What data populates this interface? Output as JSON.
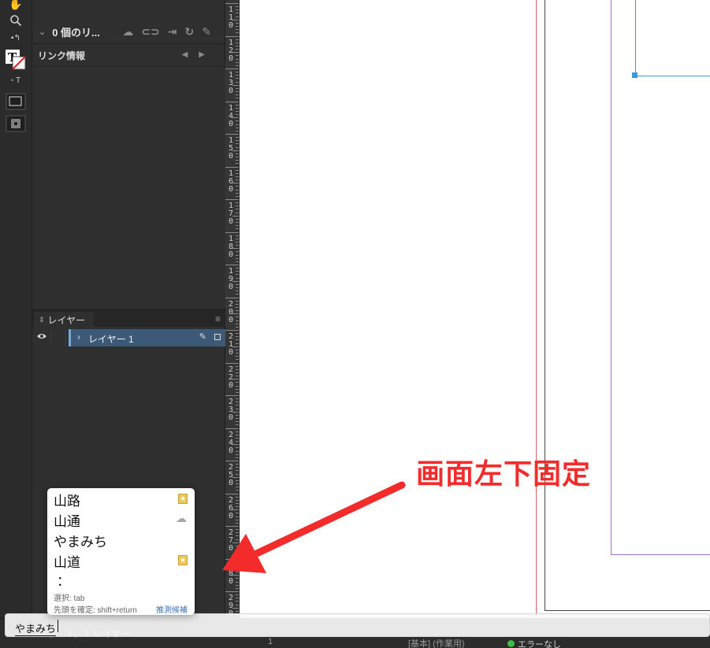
{
  "links_panel": {
    "count_label": "0 個のリ...",
    "info_label": "リンク情報"
  },
  "layers_panel": {
    "tab_label": "レイヤー",
    "layer_name": "レイヤー 1"
  },
  "ruler": {
    "labels": [
      "110",
      "120",
      "130",
      "140",
      "150",
      "160",
      "170",
      "180",
      "190",
      "200",
      "210",
      "220",
      "230",
      "240",
      "250",
      "260",
      "270",
      "280",
      "290"
    ]
  },
  "annotation": {
    "text": "画面左下固定",
    "color": "#f32b2b"
  },
  "ime": {
    "composing_text": "やまみち",
    "candidates": [
      "山路",
      "山通",
      "やまみち",
      "山道",
      "："
    ],
    "hint_select": "選択: tab",
    "hint_confirm": "先頭を確定: shift+return",
    "hint_predict": "推測候補"
  },
  "status": {
    "page_info": "ジ：1、 1 レイヤー",
    "page_number": "1",
    "style_label": "[基本] (作業用)",
    "error_label": "エラーなし"
  },
  "colors": {
    "panel_bg": "#2f2f2f",
    "selection": "#3c5a78",
    "frame_blue": "#3b9ad9",
    "margin_red": "#e05a6a",
    "margin_purple": "#a070c8"
  }
}
